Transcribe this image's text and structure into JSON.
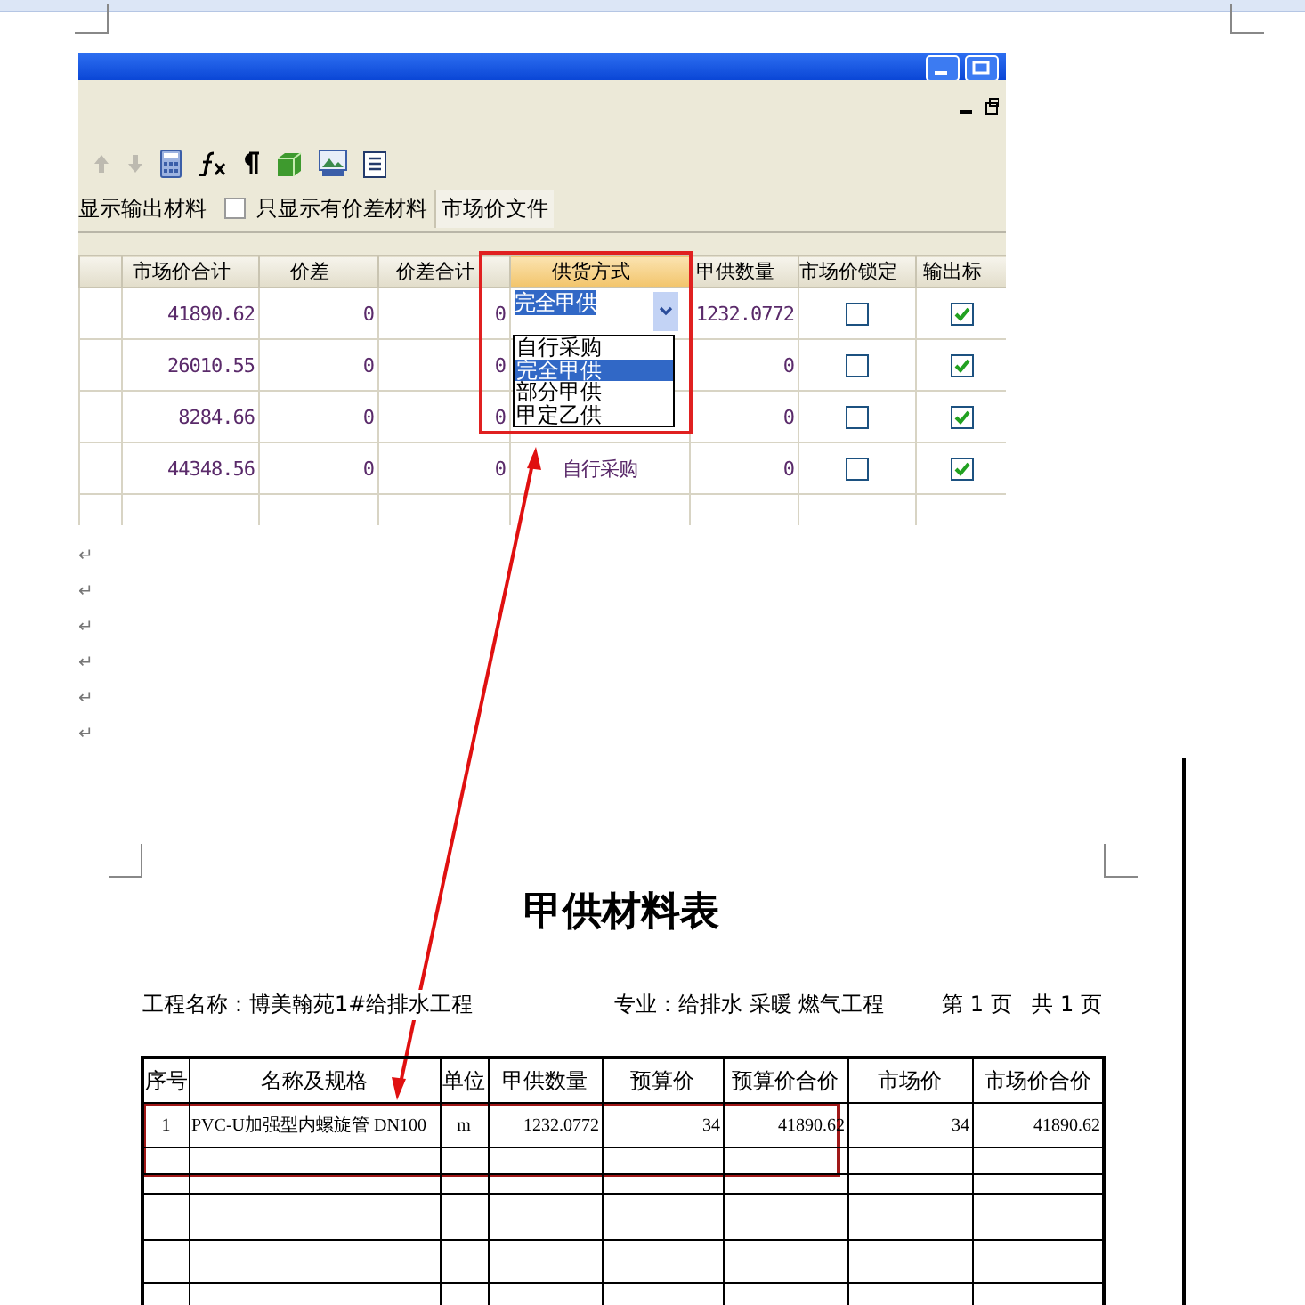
{
  "app_window": {
    "filter_bar": {
      "label": "显示输出材料",
      "checkbox": {
        "label": "只显示有价差材料",
        "checked": false
      },
      "button": "市场价文件"
    },
    "table": {
      "columns": [
        "市场价合计",
        "价差",
        "价差合计",
        "供货方式",
        "甲供数量",
        "市场价锁定",
        "输出标"
      ],
      "rows": [
        {
          "market_total": "41890.62",
          "price_diff": "0",
          "diff_total": "0",
          "supply": {
            "kind": "combo",
            "value": "完全甲供"
          },
          "supplied_qty": "1232.0772",
          "price_locked": false,
          "output": true
        },
        {
          "market_total": "26010.55",
          "price_diff": "0",
          "diff_total": "0",
          "supplied_qty": "0",
          "price_locked": false,
          "output": true
        },
        {
          "market_total": "8284.66",
          "price_diff": "0",
          "diff_total": "0",
          "supplied_qty": "0",
          "price_locked": false,
          "output": true
        },
        {
          "market_total": "44348.56",
          "price_diff": "0",
          "diff_total": "0",
          "supply": {
            "kind": "text",
            "value": "自行采购"
          },
          "supplied_qty": "0",
          "price_locked": false,
          "output": true
        }
      ]
    },
    "dropdown": {
      "options": [
        {
          "label": "自行采购",
          "selected": false
        },
        {
          "label": "完全甲供",
          "selected": true
        },
        {
          "label": "部分甲供",
          "selected": false
        },
        {
          "label": "甲定乙供",
          "selected": false
        }
      ]
    }
  },
  "paragraph_marks": [
    "↵",
    "↵",
    "↵",
    "↵",
    "↵",
    "↵"
  ],
  "report": {
    "title": "甲供材料表",
    "project": "工程名称：博美翰苑1#给排水工程",
    "specialty": "专业：给排水 采暖 燃气工程",
    "page_info": "第 1 页   共 1 页",
    "columns": [
      "序号",
      "名称及规格",
      "单位",
      "甲供数量",
      "预算价",
      "预算价合价",
      "市场价",
      "市场价合价"
    ],
    "rows": [
      [
        "1",
        "PVC-U加强型内螺旋管 DN100",
        "m",
        "1232.0772",
        "34",
        "41890.62",
        "34",
        "41890.62"
      ]
    ]
  }
}
